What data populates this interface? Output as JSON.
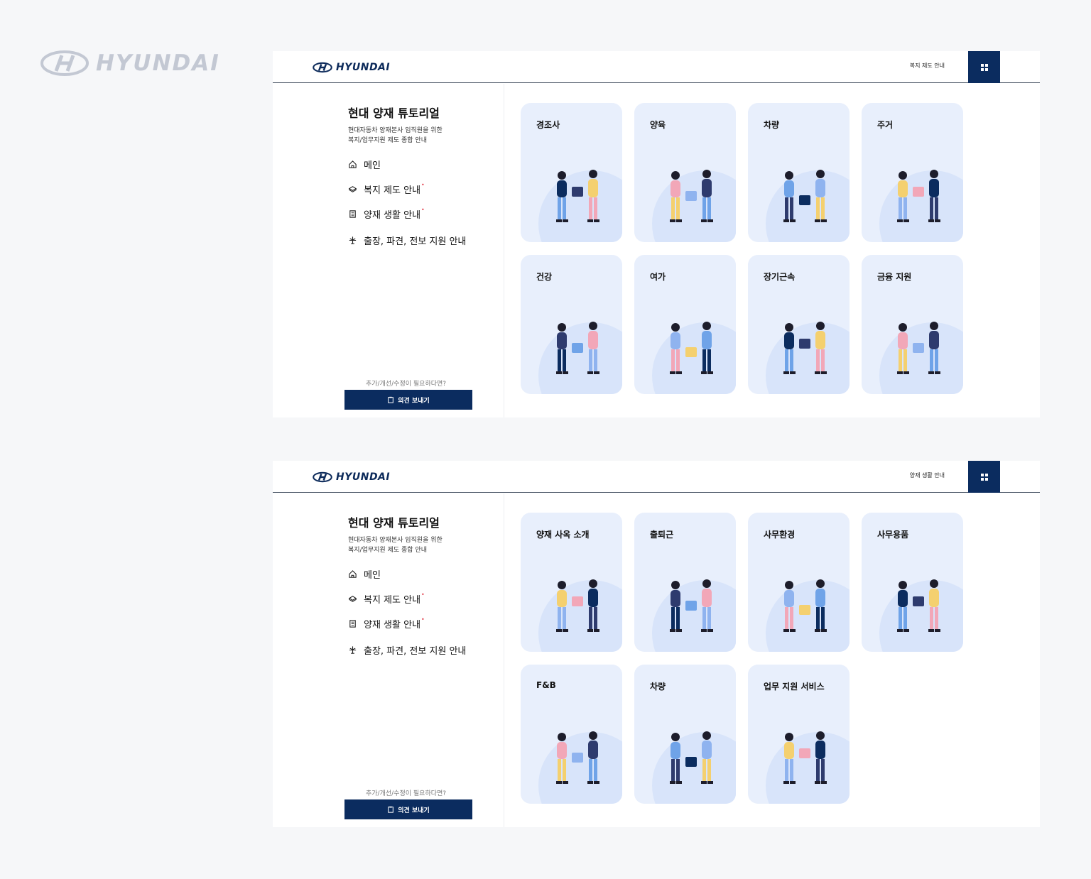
{
  "brand": {
    "wordmark": "HYUNDAI"
  },
  "screens": [
    {
      "header": {
        "logo_text": "HYUNDAI",
        "breadcrumb": "복지 제도 안내"
      },
      "sidebar": {
        "title": "현대 양재 튜토리얼",
        "subtitle_line1": "현대자동차 양재본사 임직원을 위한",
        "subtitle_line2": "복지/업무지원 제도 종합 안내",
        "nav": [
          {
            "label": "메인",
            "icon": "home-icon"
          },
          {
            "label": "복지 제도 안내",
            "icon": "gift-icon",
            "dot": "•"
          },
          {
            "label": "양재 생활 안내",
            "icon": "building-icon",
            "dot": "•"
          },
          {
            "label": "출장, 파견, 전보 지원 안내",
            "icon": "plane-icon"
          }
        ],
        "feedback_prompt": "추가/개선/수정이 필요하다면?",
        "feedback_button": "의견 보내기"
      },
      "cards": [
        {
          "label": "경조사",
          "illustration": "gift-exchange"
        },
        {
          "label": "양육",
          "illustration": "stroller"
        },
        {
          "label": "차량",
          "illustration": "car-person"
        },
        {
          "label": "주거",
          "illustration": "couple-sofa"
        },
        {
          "label": "건강",
          "illustration": "running-people"
        },
        {
          "label": "여가",
          "illustration": "laptop-chair"
        },
        {
          "label": "장기근속",
          "illustration": "colleagues"
        },
        {
          "label": "금융 지원",
          "illustration": "coin-people"
        }
      ]
    },
    {
      "header": {
        "logo_text": "HYUNDAI",
        "breadcrumb": "양재 생활 안내"
      },
      "sidebar": {
        "title": "현대 양재 튜토리얼",
        "subtitle_line1": "현대자동차 양재본사 임직원을 위한",
        "subtitle_line2": "복지/업무지원 제도 종합 안내",
        "nav": [
          {
            "label": "메인",
            "icon": "home-icon"
          },
          {
            "label": "복지 제도 안내",
            "icon": "gift-icon",
            "dot": "•"
          },
          {
            "label": "양재 생활 안내",
            "icon": "building-icon",
            "dot": "•"
          },
          {
            "label": "출장, 파견, 전보 지원 안내",
            "icon": "plane-icon"
          }
        ],
        "feedback_prompt": "추가/개선/수정이 필요하다면?",
        "feedback_button": "의견 보내기"
      },
      "cards": [
        {
          "label": "양재 사옥 소개",
          "illustration": "armchair-laptop"
        },
        {
          "label": "출퇴근",
          "illustration": "commuter"
        },
        {
          "label": "사무환경",
          "illustration": "presentation"
        },
        {
          "label": "사무용품",
          "illustration": "desk-worker"
        },
        {
          "label": "F&B",
          "illustration": "cafe-table"
        },
        {
          "label": "차량",
          "illustration": "car-luggage"
        },
        {
          "label": "업무 지원 서비스",
          "illustration": "two-workers"
        }
      ]
    }
  ],
  "colors": {
    "navy": "#0b2c5f",
    "card": "#e8effc",
    "blob": "#d8e4fa",
    "page": "#f6f7f9",
    "accent_dot": "#e3424f"
  }
}
